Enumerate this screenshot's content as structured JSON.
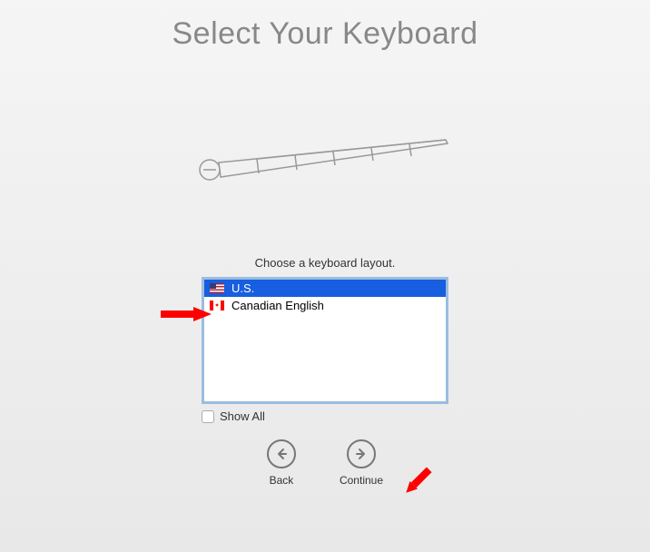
{
  "title": "Select Your Keyboard",
  "instruction": "Choose a keyboard layout.",
  "options": [
    {
      "label": "U.S.",
      "flag": "us",
      "selected": true
    },
    {
      "label": "Canadian English",
      "flag": "ca",
      "selected": false
    }
  ],
  "showall": {
    "label": "Show All",
    "checked": false
  },
  "nav": {
    "back": "Back",
    "continue": "Continue"
  }
}
